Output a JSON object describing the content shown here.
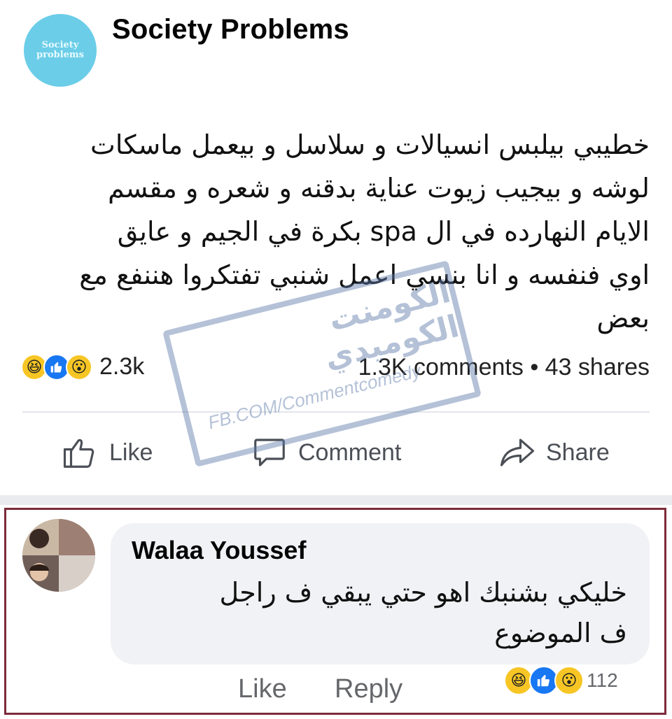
{
  "post": {
    "page_name": "Society Problems",
    "avatar_text": [
      "Society",
      "problems"
    ],
    "text_lines": [
      "خطيبي بيلبس انسيالات و سلاسل و بيعمل ماسكات",
      "لوشه و بيجيب زيوت عناية بدقنه و شعره و مقسم",
      "الايام النهارده في ال spa بكرة في الجيم و عايق",
      "اوي فنفسه و انا بنسي اعمل شنبي تفتكروا هننفع مع",
      "بعض"
    ],
    "reaction_icons": [
      "haha-icon",
      "like-icon",
      "wow-icon"
    ],
    "reaction_count": "2.3k",
    "comments_count": "1.3K comments",
    "separator": "•",
    "shares_count": "43 shares",
    "actions": {
      "like": "Like",
      "comment": "Comment",
      "share": "Share"
    }
  },
  "watermark": {
    "title": "الكومنت الكوميدي",
    "url": "FB.COM/Commentcomedy"
  },
  "comment": {
    "author": "Walaa Youssef",
    "text_lines": [
      "خليكي بشنبك اهو حتي يبقي ف راجل",
      "ف الموضوع"
    ],
    "like_label": "Like",
    "reply_label": "Reply",
    "reaction_count": "112"
  },
  "colors": {
    "accent": "#1877f2",
    "frame": "#7d2b3a",
    "bubble": "#f0f2f5",
    "page_avatar": "#6bcde8"
  }
}
